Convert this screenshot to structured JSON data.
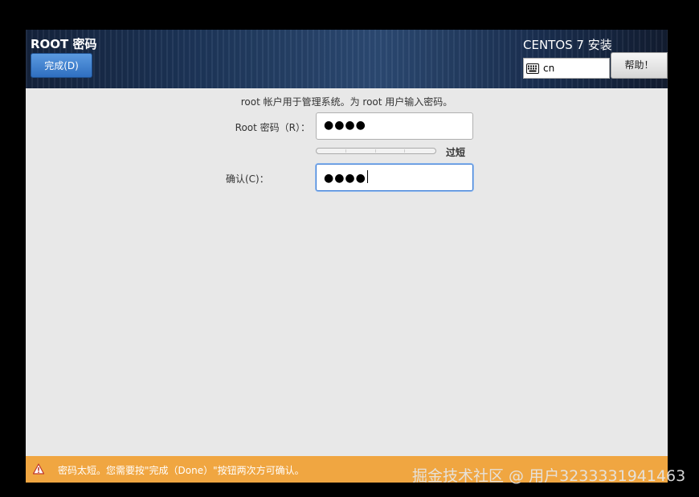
{
  "header": {
    "screen_title": "ROOT 密码",
    "done_label": "完成(D)",
    "product_title": "CENTOS 7 安装",
    "keyboard_layout": "cn",
    "help_label": "帮助！"
  },
  "form": {
    "description": "root 帐户用于管理系统。为 root 用户输入密码。",
    "password_label": "Root 密码（R）：",
    "password_mask": "●●●●",
    "strength_label": "过短",
    "strength_fraction": 0,
    "confirm_label": "确认(C)：",
    "confirm_mask": "●●●●"
  },
  "warning": {
    "icon": "warning-triangle-icon",
    "text": "密码太短。您需要按\"完成（Done）\"按钮两次方可确认。"
  },
  "watermark": "掘金技术社区 @ 用户3233331941463",
  "colors": {
    "warning_bar": "#f0a641",
    "done_button": "#3f82d1",
    "focus_border": "#3a7bd5"
  }
}
